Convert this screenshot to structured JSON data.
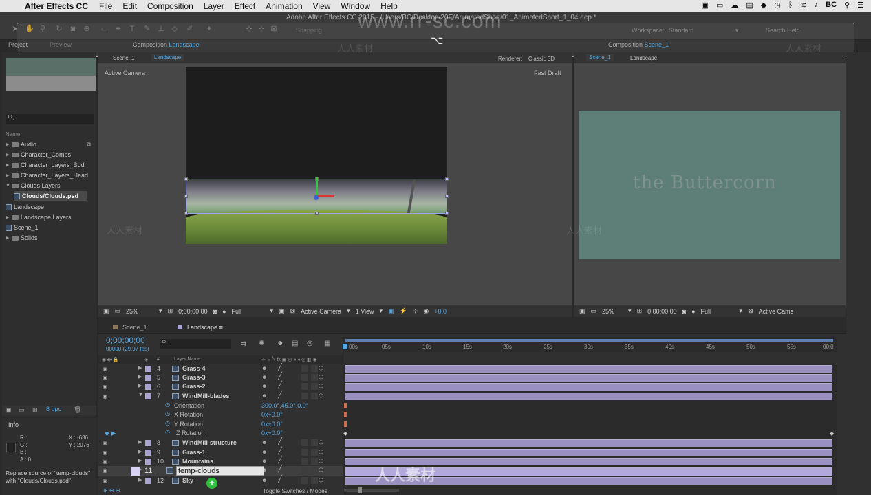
{
  "menubar": {
    "app_name": "After Effects CC",
    "items": [
      "File",
      "Edit",
      "Composition",
      "Layer",
      "Effect",
      "Animation",
      "View",
      "Window",
      "Help"
    ],
    "user": "BC"
  },
  "window": {
    "title": "Adobe After Effects CC 2015 - /Users/BC/Desktop/20E/AnimatedShort/01_AnimatedShort_1_04.aep *",
    "snapping": "Snapping",
    "workspace_label": "Workspace:",
    "workspace_value": "Standard",
    "search_help": "Search Help"
  },
  "overlay": {
    "shortcut_glyph": "⌥",
    "watermark_url": "www.rr-sc.com",
    "watermark_cn": "人人素材"
  },
  "project_panel": {
    "tab_project": "Project",
    "tab_preview": "Preview",
    "search_placeholder": "⚲.",
    "name_header": "Name",
    "items": [
      {
        "label": "Audio",
        "type": "folder"
      },
      {
        "label": "Character_Comps",
        "type": "folder"
      },
      {
        "label": "Character_Layers_Bodi",
        "type": "folder"
      },
      {
        "label": "Character_Layers_Head",
        "type": "folder"
      },
      {
        "label": "Clouds Layers",
        "type": "folder-open"
      },
      {
        "label": "Clouds/Clouds.psd",
        "type": "file",
        "selected": true
      },
      {
        "label": "Landscape",
        "type": "comp"
      },
      {
        "label": "Landscape Layers",
        "type": "folder"
      },
      {
        "label": "Scene_1",
        "type": "comp"
      },
      {
        "label": "Solids",
        "type": "folder"
      }
    ],
    "bpc": "8 bpc"
  },
  "info_panel": {
    "title": "Info",
    "rgb": "R :\nG :\nB :\nA : 0",
    "xy": "X : -636\nY : 2076",
    "message": "Replace source of \"temp-clouds\" with \"Clouds/Clouds.psd\""
  },
  "comp_left": {
    "panel_label": "Composition",
    "comp_name": "Landscape",
    "breadcrumb_scene": "Scene_1",
    "breadcrumb_comp": "Landscape",
    "renderer_label": "Renderer:",
    "renderer_value": "Classic 3D",
    "active_camera": "Active Camera",
    "fast_draft": "Fast Draft",
    "zoom": "25%",
    "timecode": "0;00;00;00",
    "resolution": "Full",
    "camera": "Active Camera",
    "views": "1 View",
    "exposure": "+0.0"
  },
  "comp_right": {
    "panel_label": "Composition",
    "comp_name": "Scene_1",
    "breadcrumb_scene": "Scene_1",
    "breadcrumb_comp": "Landscape",
    "title_art": "the Buttercorn",
    "zoom": "25%",
    "timecode": "0;00;00;00",
    "resolution": "Full",
    "camera": "Active Came"
  },
  "timeline": {
    "tabs": [
      "Scene_1",
      "Landscape"
    ],
    "timecode": "0;00;00;00",
    "fps": "00000 (29.97 fps)",
    "search_placeholder": "⚲.",
    "layer_name_header": "Layer Name",
    "ruler": [
      "00s",
      "05s",
      "10s",
      "15s",
      "20s",
      "25s",
      "30s",
      "35s",
      "40s",
      "45s",
      "50s",
      "55s",
      "00:0"
    ],
    "layers_top": [
      {
        "num": "4",
        "name": "Grass-4"
      },
      {
        "num": "5",
        "name": "Grass-3"
      },
      {
        "num": "6",
        "name": "Grass-2"
      },
      {
        "num": "7",
        "name": "WindMill-blades"
      }
    ],
    "properties": [
      {
        "name": "Orientation",
        "value": "300.0°,45.0°,0.0°"
      },
      {
        "name": "X Rotation",
        "value": "0x+0.0°"
      },
      {
        "name": "Y Rotation",
        "value": "0x+0.0°"
      },
      {
        "name": "Z Rotation",
        "value": "0x+0.0°"
      }
    ],
    "layers_bottom": [
      {
        "num": "8",
        "name": "WindMill-structure"
      },
      {
        "num": "9",
        "name": "Grass-1"
      },
      {
        "num": "10",
        "name": "Mountains"
      },
      {
        "num": "11",
        "name": "temp-clouds"
      },
      {
        "num": "12",
        "name": "Sky"
      }
    ],
    "editing_value": "temp-clouds",
    "toggle_label": "Toggle Switches / Modes"
  }
}
